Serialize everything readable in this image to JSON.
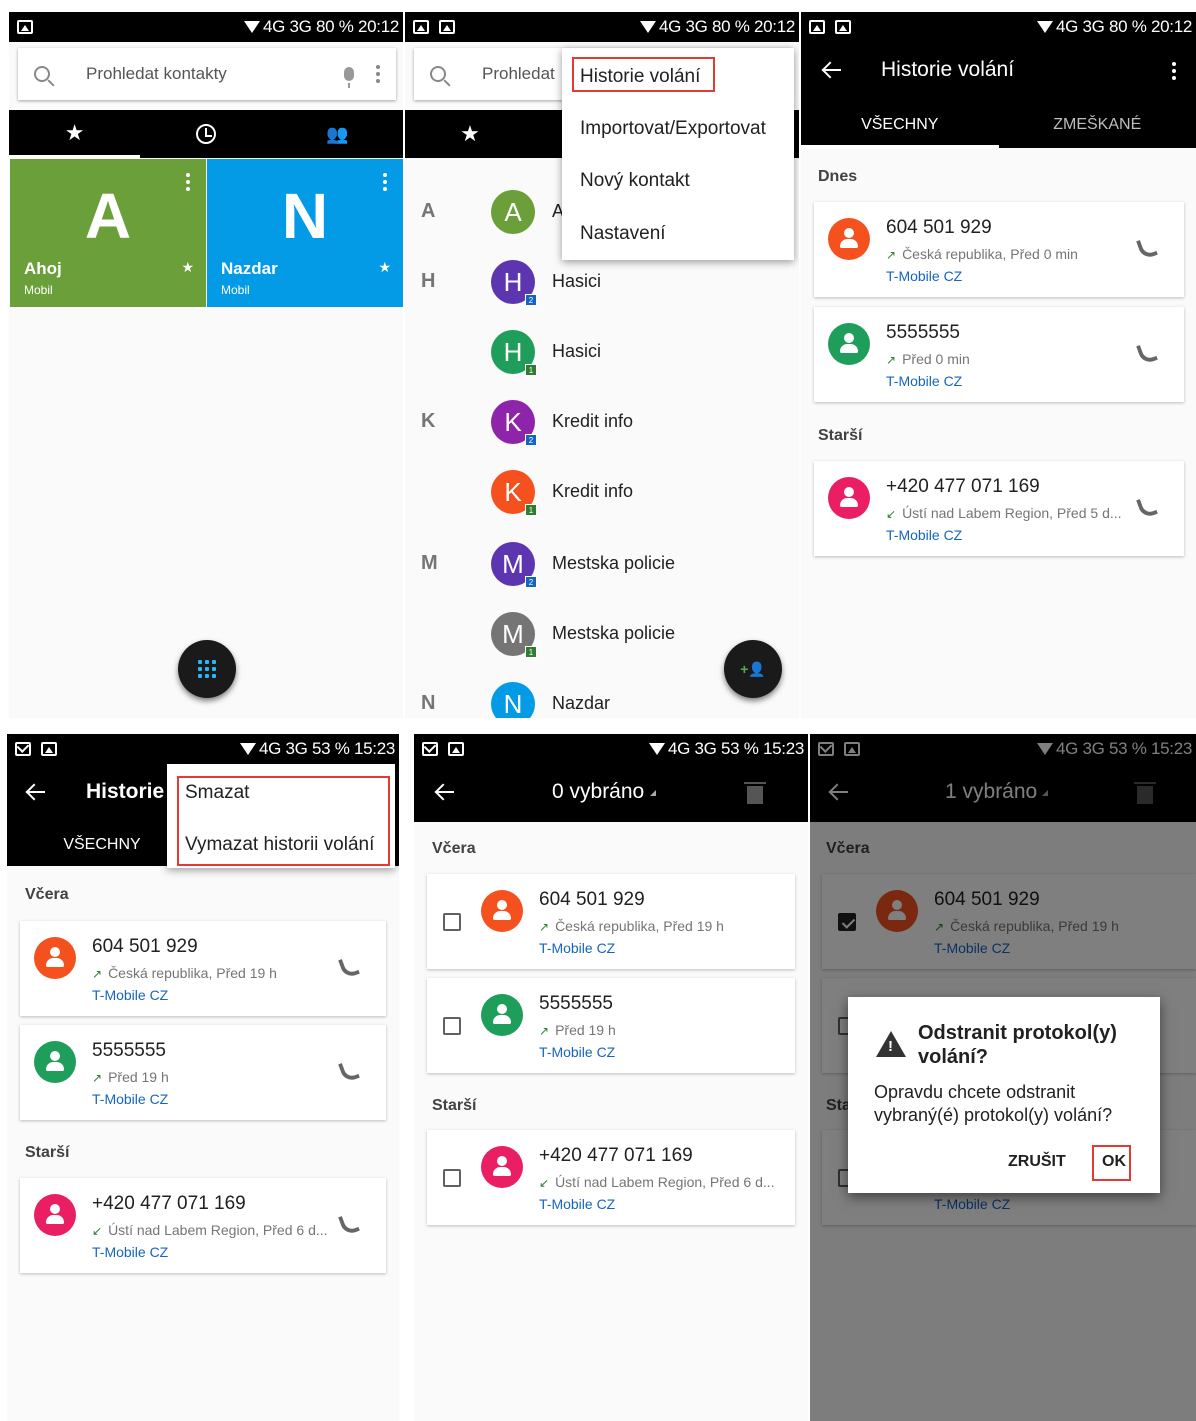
{
  "statusbar_top": {
    "text": "4G 3G 80 % 20:12"
  },
  "statusbar_bottom": {
    "text": "4G 3G 53 % 15:23"
  },
  "s1": {
    "search_placeholder": "Prohledat kontakty",
    "favorites": [
      {
        "letter": "A",
        "name": "Ahoj",
        "type": "Mobil",
        "color": "#6a9f3a"
      },
      {
        "letter": "N",
        "name": "Nazdar",
        "type": "Mobil",
        "color": "#039be5"
      }
    ]
  },
  "s2": {
    "search_placeholder": "Prohledat",
    "menu": [
      "Historie volání",
      "Importovat/Exportovat",
      "Nový kontakt",
      "Nastavení"
    ],
    "sections": [
      "A",
      "H",
      "K",
      "M",
      "N"
    ],
    "contacts": [
      {
        "initial": "A",
        "name": "A",
        "color": "#6a9f3a",
        "badge": ""
      },
      {
        "initial": "H",
        "name": "Hasici",
        "color": "#5e35b1",
        "badge": "2"
      },
      {
        "initial": "H",
        "name": "Hasici",
        "color": "#1e9e5a",
        "badge": "1"
      },
      {
        "initial": "K",
        "name": "Kredit info",
        "color": "#8e24aa",
        "badge": "2"
      },
      {
        "initial": "K",
        "name": "Kredit info",
        "color": "#f4511e",
        "badge": "1"
      },
      {
        "initial": "M",
        "name": "Mestska policie",
        "color": "#5e35b1",
        "badge": "2"
      },
      {
        "initial": "M",
        "name": "Mestska policie",
        "color": "#757575",
        "badge": "1"
      },
      {
        "initial": "N",
        "name": "Nazdar",
        "color": "#039be5",
        "badge": ""
      }
    ]
  },
  "s3": {
    "title": "Historie volání",
    "tab_all": "VŠECHNY",
    "tab_missed": "ZMEŠKANÉ",
    "today": "Dnes",
    "older": "Starší",
    "calls": [
      {
        "number": "604 501 929",
        "detail": "Česká republika, Před 0 min",
        "operator": "T-Mobile CZ",
        "color": "#f4511e",
        "dir": "out"
      },
      {
        "number": "5555555",
        "detail": "Před 0 min",
        "operator": "T-Mobile CZ",
        "color": "#1e9e5a",
        "dir": "out"
      },
      {
        "number": "+420 477 071 169",
        "detail": "Ústí nad Labem Region, Před 5 d...",
        "operator": "T-Mobile CZ",
        "color": "#e91e63",
        "dir": "in"
      }
    ]
  },
  "s4": {
    "title": "Historie",
    "tab_all": "VŠECHNY",
    "menu": [
      "Smazat",
      "Vymazat historii volání"
    ],
    "yesterday": "Včera",
    "older": "Starší",
    "calls": [
      {
        "number": "604 501 929",
        "detail": "Česká republika, Před 19 h",
        "operator": "T-Mobile CZ",
        "color": "#f4511e",
        "dir": "out"
      },
      {
        "number": "5555555",
        "detail": "Před 19 h",
        "operator": "T-Mobile CZ",
        "color": "#1e9e5a",
        "dir": "out"
      },
      {
        "number": "+420 477 071 169",
        "detail": "Ústí nad Labem Region, Před 6 d...",
        "operator": "T-Mobile CZ",
        "color": "#e91e63",
        "dir": "in"
      }
    ]
  },
  "s5": {
    "title": "0 vybráno",
    "yesterday": "Včera",
    "older": "Starší",
    "calls": [
      {
        "number": "604 501 929",
        "detail": "Česká republika, Před 19 h",
        "operator": "T-Mobile CZ",
        "color": "#f4511e",
        "dir": "out"
      },
      {
        "number": "5555555",
        "detail": "Před 19 h",
        "operator": "T-Mobile CZ",
        "color": "#1e9e5a",
        "dir": "out"
      },
      {
        "number": "+420 477 071 169",
        "detail": "Ústí nad Labem Region, Před 6 d...",
        "operator": "T-Mobile CZ",
        "color": "#e91e63",
        "dir": "in"
      }
    ]
  },
  "s6": {
    "title": "1 vybráno",
    "yesterday": "Včera",
    "older": "Sta",
    "call": {
      "number": "604 501 929",
      "detail": "Česká republika, Před 19 h",
      "operator": "T-Mobile CZ",
      "color": "#f4511e"
    },
    "operator_bottom": "T-Mobile CZ",
    "dialog": {
      "title": "Odstranit protokol(y) volání?",
      "message": "Opravdu chcete odstranit vybraný(é) protokol(y) volání?",
      "cancel": "ZRUŠIT",
      "ok": "OK"
    }
  }
}
